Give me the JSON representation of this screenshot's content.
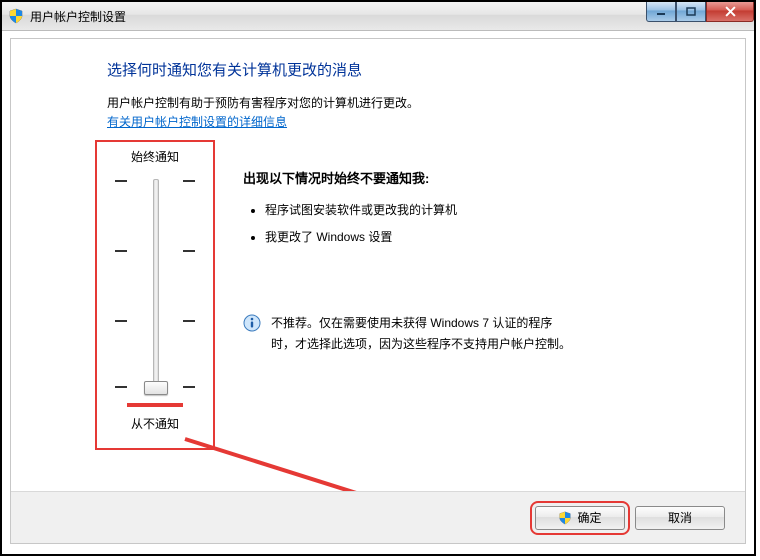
{
  "window": {
    "title": "用户帐户控制设置"
  },
  "page": {
    "heading": "选择何时通知您有关计算机更改的消息",
    "intro_line": "用户帐户控制有助于预防有害程序对您的计算机进行更改。",
    "help_link": "有关用户帐户控制设置的详细信息"
  },
  "slider": {
    "top_label": "始终通知",
    "bottom_label": "从不通知",
    "level_count": 4,
    "current_level_index": 3
  },
  "level_detail": {
    "title": "出现以下情况时始终不要通知我:",
    "bullets": [
      "程序试图安装软件或更改我的计算机",
      "我更改了 Windows 设置"
    ],
    "info_text": "不推荐。仅在需要使用未获得 Windows 7 认证的程序时，才选择此选项，因为这些程序不支持用户帐户控制。"
  },
  "buttons": {
    "ok": "确定",
    "cancel": "取消"
  }
}
